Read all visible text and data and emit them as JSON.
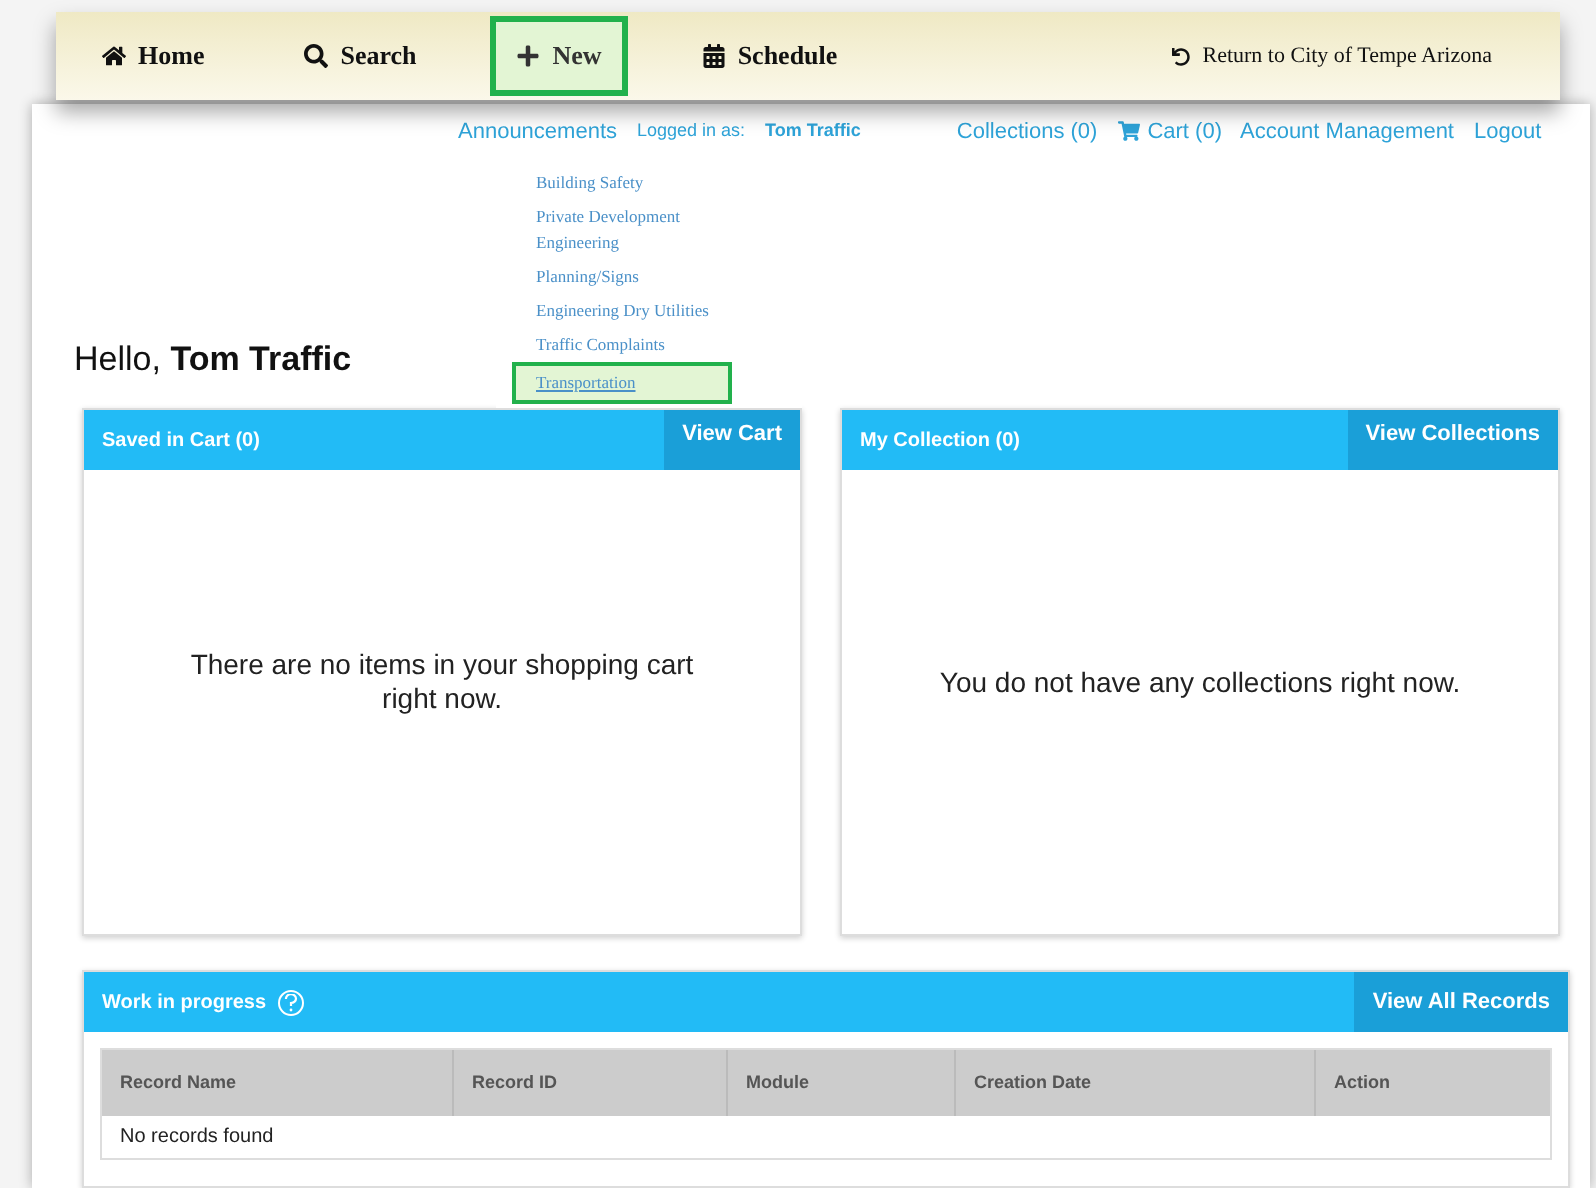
{
  "nav": {
    "items": [
      {
        "label": "Home",
        "selected": false
      },
      {
        "label": "Search",
        "selected": false
      },
      {
        "label": "New",
        "selected": true
      },
      {
        "label": "Schedule",
        "selected": false
      }
    ],
    "return_link": "Return to City of Tempe Arizona"
  },
  "top_links": {
    "announcements": "Announcements",
    "logged_in_label": "Logged in as:",
    "user": "Tom Traffic",
    "collections": "Collections (0)",
    "cart": "Cart (0)",
    "account": "Account Management",
    "logout": "Logout"
  },
  "new_menu": [
    {
      "label": "Building Safety",
      "selected": false
    },
    {
      "label": "Private Development Engineering",
      "selected": false
    },
    {
      "label": "Planning/Signs",
      "selected": false
    },
    {
      "label": "Engineering Dry Utilities",
      "selected": false
    },
    {
      "label": "Traffic Complaints",
      "selected": false
    },
    {
      "label": "Transportation",
      "selected": true
    }
  ],
  "greeting": {
    "prefix": "Hello,",
    "name": "Tom Traffic"
  },
  "panels": [
    {
      "title": "Saved in Cart (0)",
      "button": "View Cart",
      "message": "There are no items in your shopping cart right now."
    },
    {
      "title": "My Collection (0)",
      "button": "View Collections",
      "message": "You do not have any collections right now."
    }
  ],
  "work_in_progress": {
    "title": "Work in progress",
    "button": "View All Records",
    "columns": [
      "Record Name",
      "Record ID",
      "Module",
      "Creation Date",
      "Action"
    ],
    "empty": "No records found"
  }
}
